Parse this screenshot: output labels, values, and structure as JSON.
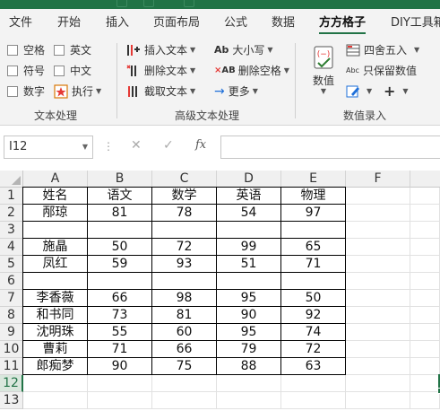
{
  "app": {
    "accent": "#217346"
  },
  "menu": {
    "tabs": [
      "文件",
      "开始",
      "插入",
      "页面布局",
      "公式",
      "数据",
      "方方格子",
      "DIY工具箱"
    ],
    "active": "方方格子"
  },
  "ribbon": {
    "text_group": {
      "label": "文本处理",
      "options": [
        "空格",
        "英文",
        "符号",
        "中文",
        "数字"
      ],
      "execute": "执行"
    },
    "advanced_group": {
      "label": "高级文本处理",
      "insert_text": "插入文本",
      "delete_text": "删除文本",
      "extract_text": "截取文本",
      "case": "大小写",
      "delete_spaces": "删除空格",
      "more": "更多"
    },
    "number_group": {
      "label": "数值录入",
      "number": "数值",
      "round": "四舍五入",
      "keep_values": "只保留数值"
    }
  },
  "formula_bar": {
    "name_box": "I12",
    "cancel_icon": "✕",
    "enter_icon": "✓",
    "fx": "fx",
    "content": ""
  },
  "sheet": {
    "columns": [
      "A",
      "B",
      "C",
      "D",
      "E",
      "F"
    ],
    "row_numbers": [
      "1",
      "2",
      "3",
      "4",
      "5",
      "6",
      "7",
      "8",
      "9",
      "10",
      "11",
      "12",
      "13"
    ],
    "selected_row": "12",
    "rows": [
      [
        "姓名",
        "语文",
        "数学",
        "英语",
        "物理"
      ],
      [
        "邴琼",
        "81",
        "78",
        "54",
        "97"
      ],
      [
        "",
        "",
        "",
        "",
        ""
      ],
      [
        "施晶",
        "50",
        "72",
        "99",
        "65"
      ],
      [
        "凤红",
        "59",
        "93",
        "51",
        "71"
      ],
      [
        "",
        "",
        "",
        "",
        ""
      ],
      [
        "李香薇",
        "66",
        "98",
        "95",
        "50"
      ],
      [
        "和书同",
        "73",
        "81",
        "90",
        "92"
      ],
      [
        "沈明珠",
        "55",
        "60",
        "95",
        "74"
      ],
      [
        "曹莉",
        "71",
        "66",
        "79",
        "72"
      ],
      [
        "郎痴梦",
        "90",
        "75",
        "88",
        "63"
      ],
      [
        "",
        "",
        "",
        "",
        ""
      ],
      [
        "",
        "",
        "",
        "",
        ""
      ]
    ]
  }
}
